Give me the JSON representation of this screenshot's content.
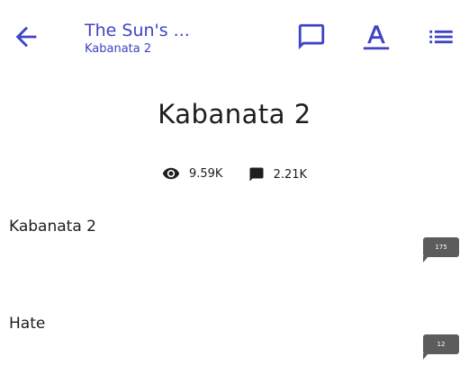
{
  "header": {
    "title": "The Sun's ...",
    "subtitle": "Kabanata 2",
    "icons": [
      "arrow-back-icon",
      "comment-icon",
      "font-settings-icon",
      "chapter-list-icon"
    ],
    "accent_color": "#3f44c4"
  },
  "chapter": {
    "title": "Kabanata 2",
    "views": "9.59K",
    "comments": "2.21K"
  },
  "paragraphs": [
    {
      "text": "Kabanata 2",
      "comment_count": "175"
    },
    {
      "text": "Hate",
      "comment_count": "12"
    }
  ]
}
